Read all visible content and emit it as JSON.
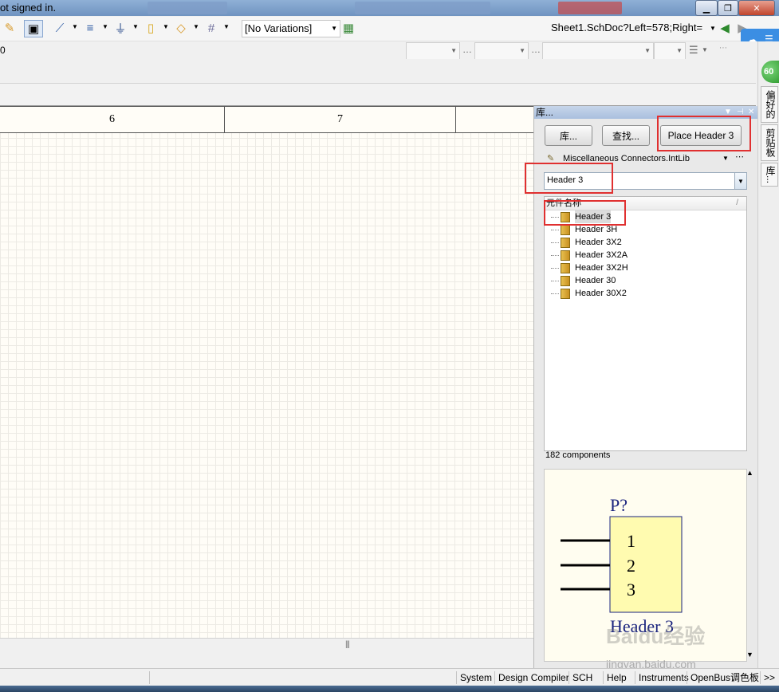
{
  "titlebar": {
    "status": "ot signed in."
  },
  "toolbar": {
    "variations": "[No Variations]",
    "sheet_path": "Sheet1.SchDoc?Left=578;Right=",
    "left_value": "0"
  },
  "ruler": {
    "zones": [
      "6",
      "7"
    ]
  },
  "library_panel": {
    "title": "库...",
    "library_button": "库...",
    "search_button": "查找...",
    "place_button": "Place Header 3",
    "library_name": "Miscellaneous Connectors.IntLib",
    "filter_value": "Header 3",
    "column_header": "元件名称",
    "components": [
      "Header 3",
      "Header 3H",
      "Header 3X2",
      "Header 3X2A",
      "Header 3X2H",
      "Header 30",
      "Header 30X2"
    ],
    "selected_index": 0,
    "count_text": "182 components",
    "preview": {
      "designator": "P?",
      "pins": [
        "1",
        "2",
        "3"
      ],
      "comment": "Header 3"
    }
  },
  "side_tabs": [
    "偏好的",
    "剪贴板",
    "库..."
  ],
  "green_badge": "60",
  "status_bar": {
    "items": [
      "System",
      "Design Compiler",
      "SCH",
      "Help",
      "Instruments",
      "OpenBus调色板",
      ">>"
    ]
  },
  "watermark": {
    "text": "Baidu经验",
    "url": "jingyan.baidu.com"
  },
  "colors": {
    "highlight_box": "#e03030",
    "sheet_background": "#fffdf7",
    "preview_body": "#fffbb0",
    "preview_text": "#1a237e"
  }
}
